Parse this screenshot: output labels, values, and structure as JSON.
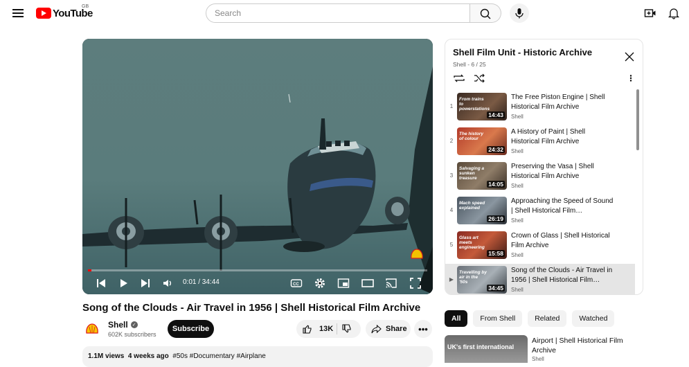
{
  "header": {
    "logo_text": "YouTube",
    "country_code": "GB",
    "search_placeholder": "Search"
  },
  "player": {
    "current_time": "0:01",
    "duration": "34:44",
    "time_display": "0:01 / 34:44",
    "progress_fraction": 0.0005
  },
  "video": {
    "title": "Song of the Clouds - Air Travel in 1956 | Shell Historical Film Archive",
    "channel_name": "Shell",
    "subscribers": "602K subscribers",
    "subscribe_label": "Subscribe",
    "likes": "13K",
    "share_label": "Share",
    "more_label": "•••",
    "views": "1.1M views",
    "age": "4 weeks ago",
    "tags": "#50s #Documentary #Airplane"
  },
  "playlist": {
    "title": "Shell Film Unit - Historic Archive",
    "subtitle": "Shell - 6 / 25",
    "items": [
      {
        "index": "1",
        "title": "The Free Piston Engine | Shell Historical Film Archive",
        "channel": "Shell",
        "duration": "14:43",
        "caption": "From trains to powerstations"
      },
      {
        "index": "2",
        "title": "A History of Paint | Shell Historical Film Archive",
        "channel": "Shell",
        "duration": "24:32",
        "caption": "The history of colour"
      },
      {
        "index": "3",
        "title": "Preserving the Vasa | Shell Historical Film Archive",
        "channel": "Shell",
        "duration": "14:05",
        "caption": "Salvaging a sunken treasure"
      },
      {
        "index": "4",
        "title": "Approaching the Speed of Sound | Shell Historical Film…",
        "channel": "Shell",
        "duration": "26:19",
        "caption": "Mach speed explained"
      },
      {
        "index": "5",
        "title": "Crown of Glass | Shell Historical Film Archive",
        "channel": "Shell",
        "duration": "15:58",
        "caption": "Glass art meets engineering"
      },
      {
        "index": "▶",
        "title": "Song of the Clouds - Air Travel in 1956 | Shell Historical Film…",
        "channel": "Shell",
        "duration": "34:45",
        "caption": "Travelling by air in the '50s"
      }
    ]
  },
  "chips": [
    "All",
    "From Shell",
    "Related",
    "Watched"
  ],
  "recommendation": {
    "title": "Airport | Shell Historical Film Archive",
    "channel": "Shell",
    "caption": "UK's first international"
  },
  "colors": {
    "accent": "#ff0000",
    "text": "#0f0f0f",
    "secondary": "#606060"
  }
}
